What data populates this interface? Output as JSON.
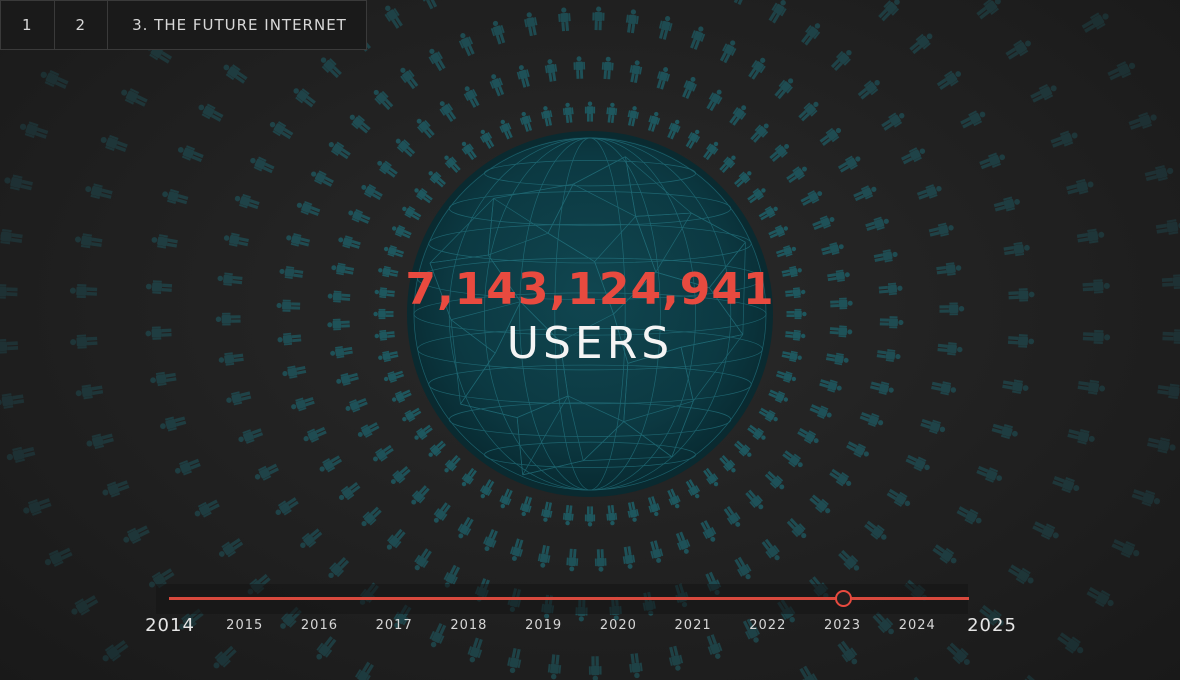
{
  "nav": {
    "tabs": [
      {
        "label": "1"
      },
      {
        "label": "2"
      },
      {
        "label": "3. THE FUTURE INTERNET"
      }
    ]
  },
  "counter": {
    "number": "7,143,124,941",
    "unit": "USERS"
  },
  "timeline": {
    "years": [
      "2014",
      "2015",
      "2016",
      "2017",
      "2018",
      "2019",
      "2020",
      "2021",
      "2022",
      "2023",
      "2024",
      "2025"
    ],
    "selected_year": "2023"
  },
  "colors": {
    "accent": "#e84a3f",
    "figure": "#1e5a62",
    "globe": "#0f3a44",
    "background": "#222222"
  },
  "icons": {
    "figure": "person-icon",
    "globe": "globe-icon"
  }
}
